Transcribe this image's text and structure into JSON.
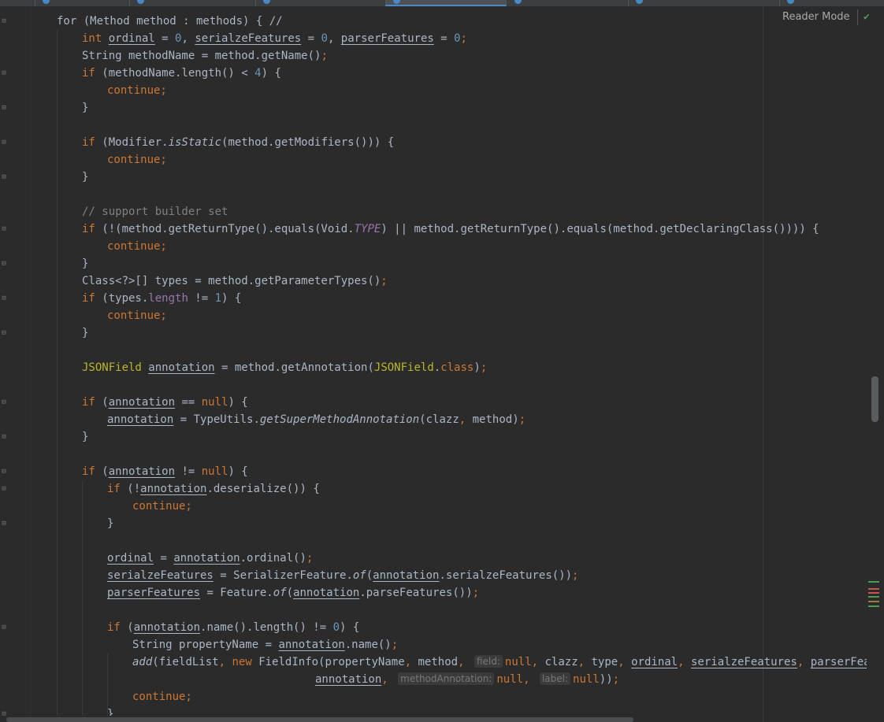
{
  "toolbar": {
    "reader_mode_label": "Reader Mode",
    "status_icon": "check-icon"
  },
  "colors": {
    "background": "#2b2b2b",
    "keyword": "#cc7832",
    "number": "#6897bb",
    "annotation": "#bbb529",
    "field": "#9876aa",
    "comment": "#808080",
    "text": "#a9b7c6"
  },
  "code": {
    "line01": "for (Method method : methods) { //",
    "line02": "int ordinal = 0, serialzeFeatures = 0, parserFeatures = 0;",
    "line03": "String methodName = method.getName();",
    "line04": "if (methodName.length() < 4) {",
    "line05": "continue;",
    "line06": "}",
    "line07": "if (Modifier.isStatic(method.getModifiers())) {",
    "line08": "continue;",
    "line09": "}",
    "line10": "// support builder set",
    "line11": "if (!(method.getReturnType().equals(Void.TYPE) || method.getReturnType().equals(method.getDeclaringClass()))) {",
    "line12": "continue;",
    "line13": "}",
    "line14": "Class<?>[] types = method.getParameterTypes();",
    "line15": "if (types.length != 1) {",
    "line16": "continue;",
    "line17": "}",
    "line18": "JSONField annotation = method.getAnnotation(JSONField.class);",
    "line19": "if (annotation == null) {",
    "line20": "annotation = TypeUtils.getSuperMethodAnnotation(clazz, method);",
    "line21": "}",
    "line22": "if (annotation != null) {",
    "line23": "if (!annotation.deserialize()) {",
    "line24": "continue;",
    "line25": "}",
    "line26": "ordinal = annotation.ordinal();",
    "line27": "serialzeFeatures = SerializerFeature.of(annotation.serialzeFeatures());",
    "line28": "parserFeatures = Feature.of(annotation.parseFeatures());",
    "line29": "if (annotation.name().length() != 0) {",
    "line30": "String propertyName = annotation.name();",
    "line31": "add(fieldList, new FieldInfo(propertyName, method, field: null, clazz, type, ordinal, serialzeFeatures, parserFeatures,",
    "line32": "annotation, methodAnnotation: null, label: null));",
    "line33": "continue;",
    "line34": "}"
  },
  "hints": {
    "field": "field:",
    "method_annotation": "methodAnnotation:",
    "label": "label:"
  }
}
